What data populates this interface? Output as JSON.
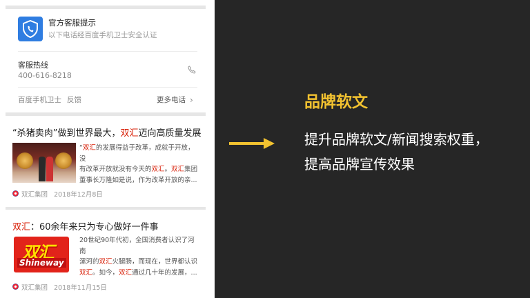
{
  "notice": {
    "title": "官方客服提示",
    "subtitle": "以下电话经百度手机卫士安全认证",
    "icon": "shield-phone-icon"
  },
  "hotline": {
    "label": "客服热线",
    "number": "400-616-8218"
  },
  "notice_footer": {
    "link1": "百度手机卫士",
    "link2": "反馈",
    "more_calls": "更多电话"
  },
  "news": [
    {
      "title_prefix": "“杀猪卖肉”做到世界最大，",
      "title_highlight": "双汇",
      "title_suffix": "迈向高质量发展",
      "snippet_line1_prefix": "“",
      "snippet_line1_highlight": "双汇",
      "snippet_line1_suffix": "的发展得益于改革，成就于开放，没",
      "snippet_line2_prefix": "有改革开放就没有今天的",
      "snippet_line2_highlight": "双汇",
      "snippet_line2_mid": "。",
      "snippet_line2_highlight2": "双汇",
      "snippet_line2_suffix": "集团",
      "snippet_line3": "董事长万隆如是说，作为改革开放的亲...",
      "source": "双汇集团",
      "date": "2018年12月8日"
    },
    {
      "title_highlight": "双汇",
      "title_suffix": "：60余年来只为专心做好一件事",
      "snippet_line1": "20世纪90年代初，全国消费者认识了河南",
      "snippet_line2_prefix": "漯河的",
      "snippet_line2_highlight": "双汇",
      "snippet_line2_suffix": "火腿肠，而现在，世界都认识",
      "snippet_line3_highlight": "双汇",
      "snippet_line3_mid": "。如今，",
      "snippet_line3_highlight2": "双汇",
      "snippet_line3_suffix": "通过几十年的发展，...",
      "logo_cn": "双汇",
      "logo_en": "Shineway",
      "source": "双汇集团",
      "date": "2018年11月15日"
    }
  ],
  "right": {
    "headline": "品牌软文",
    "desc_line1": "提升品牌软文/新闻搜索权重，",
    "desc_line2": "提高品牌宣传效果"
  },
  "colors": {
    "background": "#262626",
    "accent": "#f2c230",
    "highlight_red": "#d81e06",
    "notice_blue": "#2f7de1"
  }
}
